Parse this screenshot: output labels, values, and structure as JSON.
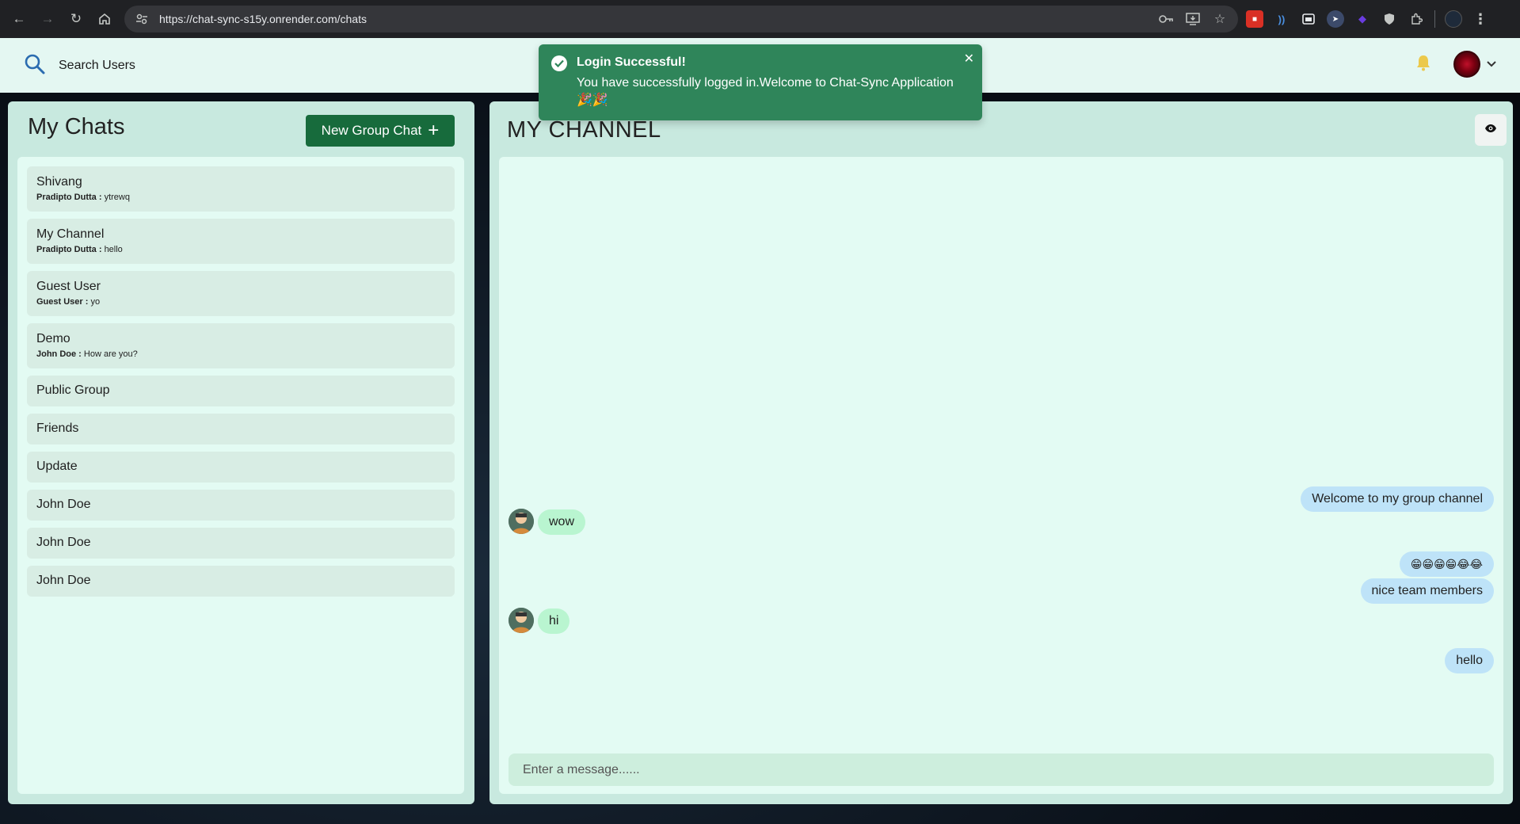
{
  "browser": {
    "url": "https://chat-sync-s15y.onrender.com/chats"
  },
  "header": {
    "search_label": "Search Users"
  },
  "toast": {
    "title": "Login Successful!",
    "description": "You have successfully logged in.Welcome to Chat-Sync Application 🎉🎉"
  },
  "left_panel": {
    "title": "My Chats",
    "new_group_label": "New Group Chat",
    "chats": [
      {
        "name": "Shivang",
        "sender": "Pradipto Dutta :",
        "message": "ytrewq"
      },
      {
        "name": "My Channel",
        "sender": "Pradipto Dutta :",
        "message": "hello"
      },
      {
        "name": "Guest User",
        "sender": "Guest User :",
        "message": "yo"
      },
      {
        "name": "Demo",
        "sender": "John Doe :",
        "message": "How are you?"
      },
      {
        "name": "Public Group"
      },
      {
        "name": "Friends"
      },
      {
        "name": "Update"
      },
      {
        "name": "John Doe"
      },
      {
        "name": "John Doe"
      },
      {
        "name": "John Doe"
      }
    ]
  },
  "right_panel": {
    "title": "MY CHANNEL",
    "messages": [
      {
        "text": "Welcome to my group channel",
        "mine": true
      },
      {
        "text": "wow",
        "mine": false
      },
      {
        "text": "😁😁😁😁😂😂",
        "mine": true
      },
      {
        "text": "nice team members",
        "mine": true
      },
      {
        "text": "hi",
        "mine": false
      },
      {
        "text": "hello",
        "mine": true
      }
    ],
    "input_placeholder": "Enter a message......"
  },
  "colors": {
    "header_bg": "#e4f7f2",
    "panel_bg": "#c8e9df",
    "inner_bg": "#e3fbf3",
    "button_green": "#176b3c",
    "toast_green": "#2f855a",
    "my_bubble": "#bee3f8",
    "their_bubble": "#b9f5d0",
    "bell": "#ecc94b"
  }
}
